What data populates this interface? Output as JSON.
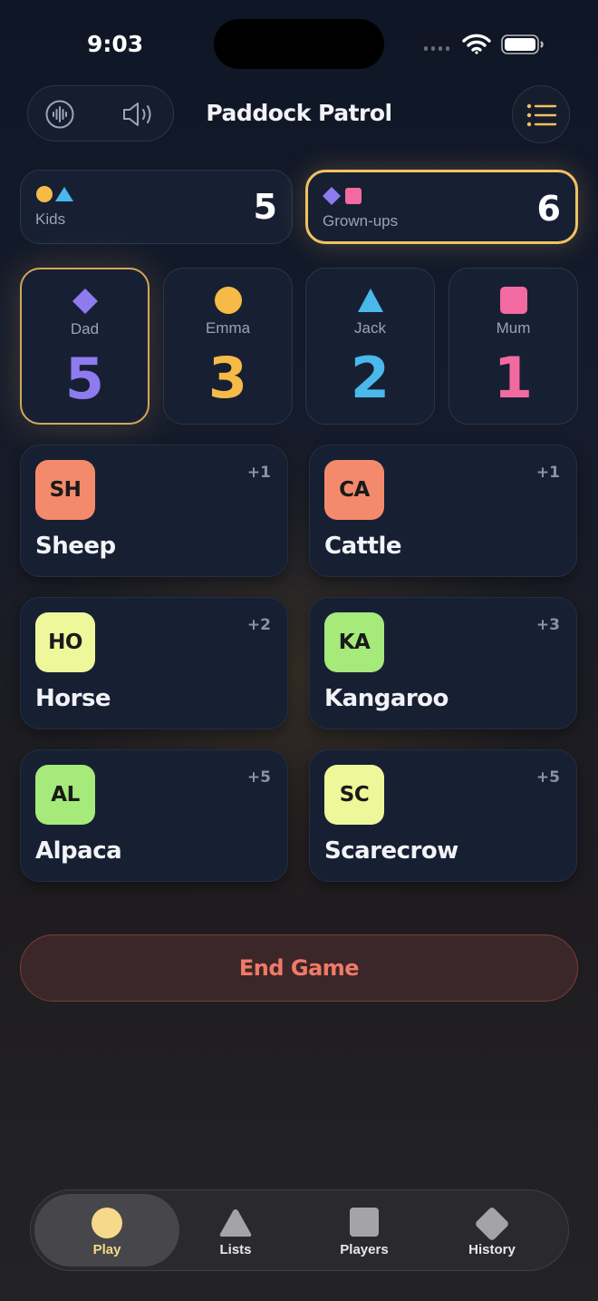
{
  "status_bar": {
    "time": "9:03"
  },
  "header": {
    "title": "Paddock Patrol",
    "voice_icon": "voice-waveform-icon",
    "sound_icon": "speaker-icon",
    "menu_icon": "list-menu-icon"
  },
  "teams": [
    {
      "name": "Kids",
      "score": "5",
      "shapes": [
        "circle",
        "triangle"
      ],
      "active": false
    },
    {
      "name": "Grown-ups",
      "score": "6",
      "shapes": [
        "diamond",
        "square"
      ],
      "active": true
    }
  ],
  "players": [
    {
      "name": "Dad",
      "score": "5",
      "shape": "diamond",
      "color": "#8f7bf0",
      "active": true
    },
    {
      "name": "Emma",
      "score": "3",
      "shape": "circle",
      "color": "#f6bb47",
      "active": false
    },
    {
      "name": "Jack",
      "score": "2",
      "shape": "triangle",
      "color": "#4bb8ec",
      "active": false
    },
    {
      "name": "Mum",
      "score": "1",
      "shape": "square",
      "color": "#f26aa0",
      "active": false
    }
  ],
  "animals": [
    {
      "code": "SH",
      "name": "Sheep",
      "points": "+1",
      "badge_color": "#f48a6c"
    },
    {
      "code": "CA",
      "name": "Cattle",
      "points": "+1",
      "badge_color": "#f48a6c"
    },
    {
      "code": "HO",
      "name": "Horse",
      "points": "+2",
      "badge_color": "#eef79a"
    },
    {
      "code": "KA",
      "name": "Kangaroo",
      "points": "+3",
      "badge_color": "#a5ea7a"
    },
    {
      "code": "AL",
      "name": "Alpaca",
      "points": "+5",
      "badge_color": "#a5ea7a"
    },
    {
      "code": "SC",
      "name": "Scarecrow",
      "points": "+5",
      "badge_color": "#eef79a"
    }
  ],
  "end_game_label": "End Game",
  "tabs": [
    {
      "label": "Play",
      "icon": "circle-icon",
      "active": true
    },
    {
      "label": "Lists",
      "icon": "triangle-icon",
      "active": false
    },
    {
      "label": "Players",
      "icon": "square-icon",
      "active": false
    },
    {
      "label": "History",
      "icon": "diamond-icon",
      "active": false
    }
  ],
  "colors": {
    "accent_gold": "#f2c162",
    "kids_circle": "#f6bb47",
    "kids_triangle": "#4bb8ec",
    "grown_diamond": "#8f7bf0",
    "grown_square": "#f26aa0",
    "end_game": "#ef7a66",
    "play_tab": "#f6d98a"
  }
}
